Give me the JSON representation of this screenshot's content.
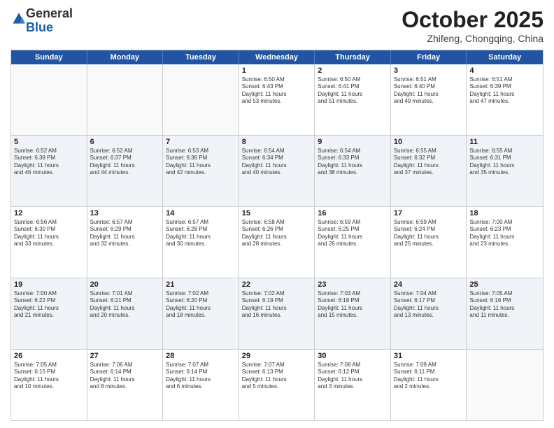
{
  "logo": {
    "general": "General",
    "blue": "Blue"
  },
  "header": {
    "month": "October 2025",
    "location": "Zhifeng, Chongqing, China"
  },
  "days": [
    "Sunday",
    "Monday",
    "Tuesday",
    "Wednesday",
    "Thursday",
    "Friday",
    "Saturday"
  ],
  "rows": [
    [
      {
        "day": "",
        "text": ""
      },
      {
        "day": "",
        "text": ""
      },
      {
        "day": "",
        "text": ""
      },
      {
        "day": "1",
        "text": "Sunrise: 6:50 AM\nSunset: 6:43 PM\nDaylight: 11 hours\nand 53 minutes."
      },
      {
        "day": "2",
        "text": "Sunrise: 6:50 AM\nSunset: 6:41 PM\nDaylight: 11 hours\nand 51 minutes."
      },
      {
        "day": "3",
        "text": "Sunrise: 6:51 AM\nSunset: 6:40 PM\nDaylight: 11 hours\nand 49 minutes."
      },
      {
        "day": "4",
        "text": "Sunrise: 6:51 AM\nSunset: 6:39 PM\nDaylight: 11 hours\nand 47 minutes."
      }
    ],
    [
      {
        "day": "5",
        "text": "Sunrise: 6:52 AM\nSunset: 6:38 PM\nDaylight: 11 hours\nand 46 minutes."
      },
      {
        "day": "6",
        "text": "Sunrise: 6:52 AM\nSunset: 6:37 PM\nDaylight: 11 hours\nand 44 minutes."
      },
      {
        "day": "7",
        "text": "Sunrise: 6:53 AM\nSunset: 6:36 PM\nDaylight: 11 hours\nand 42 minutes."
      },
      {
        "day": "8",
        "text": "Sunrise: 6:54 AM\nSunset: 6:34 PM\nDaylight: 11 hours\nand 40 minutes."
      },
      {
        "day": "9",
        "text": "Sunrise: 6:54 AM\nSunset: 6:33 PM\nDaylight: 11 hours\nand 38 minutes."
      },
      {
        "day": "10",
        "text": "Sunrise: 6:55 AM\nSunset: 6:32 PM\nDaylight: 11 hours\nand 37 minutes."
      },
      {
        "day": "11",
        "text": "Sunrise: 6:55 AM\nSunset: 6:31 PM\nDaylight: 11 hours\nand 35 minutes."
      }
    ],
    [
      {
        "day": "12",
        "text": "Sunrise: 6:56 AM\nSunset: 6:30 PM\nDaylight: 11 hours\nand 33 minutes."
      },
      {
        "day": "13",
        "text": "Sunrise: 6:57 AM\nSunset: 6:29 PM\nDaylight: 11 hours\nand 32 minutes."
      },
      {
        "day": "14",
        "text": "Sunrise: 6:57 AM\nSunset: 6:28 PM\nDaylight: 11 hours\nand 30 minutes."
      },
      {
        "day": "15",
        "text": "Sunrise: 6:58 AM\nSunset: 6:26 PM\nDaylight: 11 hours\nand 28 minutes."
      },
      {
        "day": "16",
        "text": "Sunrise: 6:59 AM\nSunset: 6:25 PM\nDaylight: 11 hours\nand 26 minutes."
      },
      {
        "day": "17",
        "text": "Sunrise: 6:59 AM\nSunset: 6:24 PM\nDaylight: 11 hours\nand 25 minutes."
      },
      {
        "day": "18",
        "text": "Sunrise: 7:00 AM\nSunset: 6:23 PM\nDaylight: 11 hours\nand 23 minutes."
      }
    ],
    [
      {
        "day": "19",
        "text": "Sunrise: 7:00 AM\nSunset: 6:22 PM\nDaylight: 11 hours\nand 21 minutes."
      },
      {
        "day": "20",
        "text": "Sunrise: 7:01 AM\nSunset: 6:21 PM\nDaylight: 11 hours\nand 20 minutes."
      },
      {
        "day": "21",
        "text": "Sunrise: 7:02 AM\nSunset: 6:20 PM\nDaylight: 11 hours\nand 18 minutes."
      },
      {
        "day": "22",
        "text": "Sunrise: 7:02 AM\nSunset: 6:19 PM\nDaylight: 11 hours\nand 16 minutes."
      },
      {
        "day": "23",
        "text": "Sunrise: 7:03 AM\nSunset: 6:18 PM\nDaylight: 11 hours\nand 15 minutes."
      },
      {
        "day": "24",
        "text": "Sunrise: 7:04 AM\nSunset: 6:17 PM\nDaylight: 11 hours\nand 13 minutes."
      },
      {
        "day": "25",
        "text": "Sunrise: 7:05 AM\nSunset: 6:16 PM\nDaylight: 11 hours\nand 11 minutes."
      }
    ],
    [
      {
        "day": "26",
        "text": "Sunrise: 7:05 AM\nSunset: 6:15 PM\nDaylight: 11 hours\nand 10 minutes."
      },
      {
        "day": "27",
        "text": "Sunrise: 7:06 AM\nSunset: 6:14 PM\nDaylight: 11 hours\nand 8 minutes."
      },
      {
        "day": "28",
        "text": "Sunrise: 7:07 AM\nSunset: 6:14 PM\nDaylight: 11 hours\nand 6 minutes."
      },
      {
        "day": "29",
        "text": "Sunrise: 7:07 AM\nSunset: 6:13 PM\nDaylight: 11 hours\nand 5 minutes."
      },
      {
        "day": "30",
        "text": "Sunrise: 7:08 AM\nSunset: 6:12 PM\nDaylight: 11 hours\nand 3 minutes."
      },
      {
        "day": "31",
        "text": "Sunrise: 7:09 AM\nSunset: 6:11 PM\nDaylight: 11 hours\nand 2 minutes."
      },
      {
        "day": "",
        "text": ""
      }
    ]
  ]
}
